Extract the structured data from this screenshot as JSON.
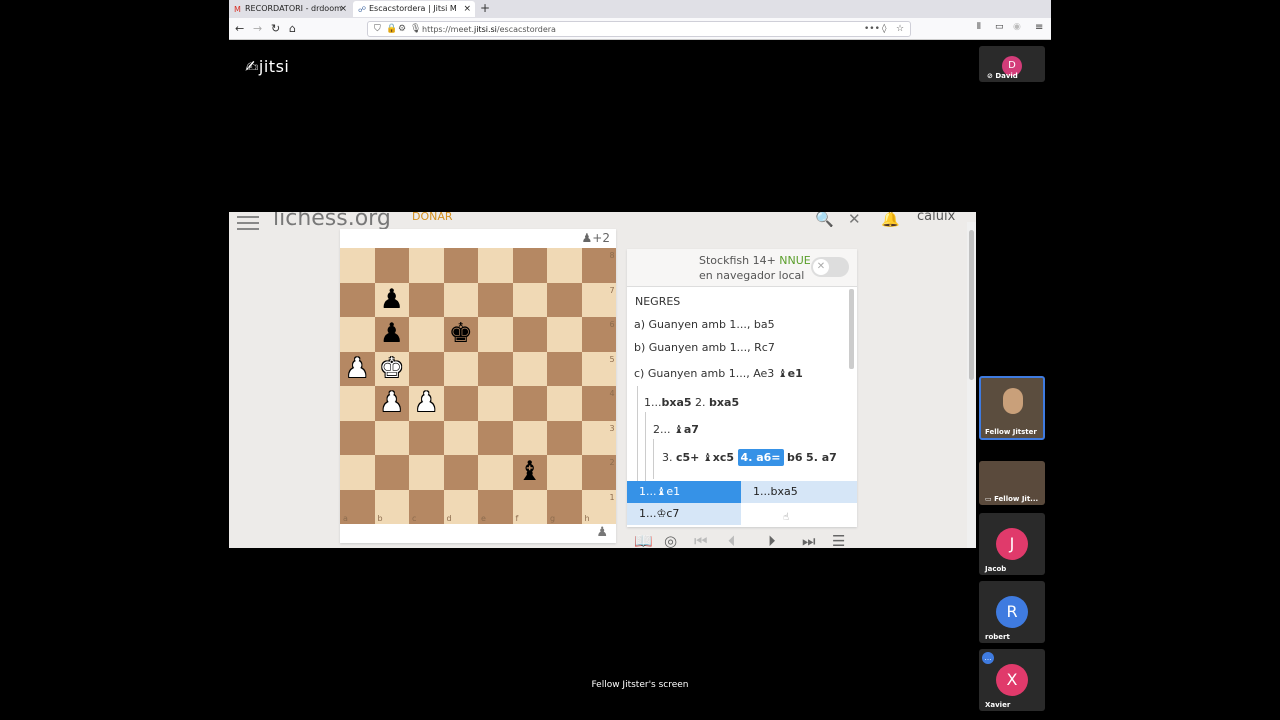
{
  "browser": {
    "tabs": [
      {
        "label": "RECORDATORI - drdoom",
        "icon": "gmail-icon"
      },
      {
        "label": "Escacstordera | Jitsi M",
        "icon": "jitsi-icon"
      }
    ],
    "url_prefix": "https://meet.",
    "url_domain": "jitsi.si",
    "url_path": "/escacstordera"
  },
  "jitsi": {
    "logo": "jitsi",
    "caption": "Fellow Jitster's screen"
  },
  "lichess": {
    "logo": "lichess.org",
    "donate": "DONAR",
    "user": "caluix",
    "score": "+2",
    "engine_name": "Stockfish 14+",
    "engine_tag": "NNUE",
    "engine_sub": "en navegador local",
    "files": [
      "a",
      "b",
      "c",
      "d",
      "e",
      "f",
      "g",
      "h"
    ],
    "ranks": [
      "8",
      "7",
      "6",
      "5",
      "4",
      "3",
      "2",
      "1"
    ],
    "comment_header": "NEGRES",
    "line_a": "a) Guanyen amb 1..., ba5",
    "line_b": "b) Guanyen amb 1..., Rc7",
    "line_c": "c) Guanyen amb 1..., Ae3",
    "line_c_move": "♝e1",
    "m1_num": "1...",
    "m1_a": "bxa5",
    "m1_b": "2.",
    "m1_c": "bxa5",
    "m2_num": "2...",
    "m2_a": "♝a7",
    "m3_num": "3.",
    "m3_a": "c5+",
    "m3_b": "♝xc5",
    "m3_cur": "4. a6=",
    "m3_c": "b6",
    "m3_d": "5. a7",
    "fork_1": "1...♝e1",
    "fork_2": "1...bxa5",
    "fork_3": "1...♔c7"
  },
  "participants": [
    {
      "name": "David",
      "initial": "D",
      "color": "#d33c79"
    },
    {
      "name": "Fellow Jitster"
    },
    {
      "name": "Fellow Jit..."
    },
    {
      "name": "Jacob",
      "initial": "J",
      "color": "#e03a6b"
    },
    {
      "name": "robert",
      "initial": "R",
      "color": "#3f7be0"
    },
    {
      "name": "Xavier",
      "initial": "X",
      "color": "#e03a6b"
    }
  ]
}
